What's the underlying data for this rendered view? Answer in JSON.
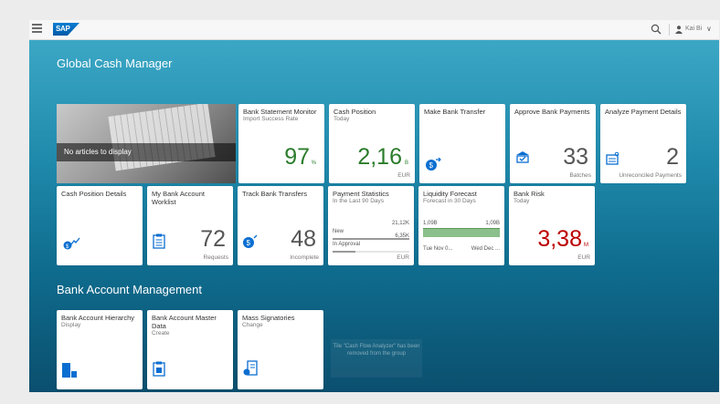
{
  "shell": {
    "logo": "SAP",
    "user_name": "Kai Bi"
  },
  "groups": {
    "global": "Global Cash Manager",
    "bank": "Bank Account Management"
  },
  "news": {
    "message": "No articles to display"
  },
  "tiles": {
    "bank_statement": {
      "title": "Bank Statement Monitor",
      "subtitle": "Import Success Rate",
      "value": "97",
      "scale": "%"
    },
    "cash_position": {
      "title": "Cash Position",
      "subtitle": "Today",
      "value": "2,16",
      "scale": "B",
      "unit": "EUR"
    },
    "make_transfer": {
      "title": "Make Bank Transfer"
    },
    "approve_payments": {
      "title": "Approve Bank Payments",
      "value": "33",
      "unit": "Batches"
    },
    "analyze_payment": {
      "title": "Analyze Payment Details",
      "value": "2",
      "unit": "Unreconciled Payments"
    },
    "cash_details": {
      "title": "Cash Position Details"
    },
    "worklist": {
      "title": "My Bank Account Worklist",
      "value": "72",
      "unit": "Requests"
    },
    "track_transfers": {
      "title": "Track Bank Transfers",
      "value": "48",
      "unit": "Incomplete"
    },
    "payment_stats": {
      "title": "Payment Statistics",
      "subtitle": "In the Last 90 Days",
      "unit": "EUR",
      "rows": [
        {
          "label": "New",
          "value": "21,12K",
          "fraction": 1.0
        },
        {
          "label": "In Approval",
          "value": "6,35K",
          "fraction": 0.3
        }
      ]
    },
    "liquidity": {
      "title": "Liquidity Forecast",
      "subtitle": "Forecast in 30 Days",
      "left_value": "1,09B",
      "right_value": "1,09B",
      "left_date": "Tue Nov 0...",
      "right_date": "Wed Dec ..."
    },
    "bank_risk": {
      "title": "Bank Risk",
      "subtitle": "Today",
      "value": "3,38",
      "scale": "M",
      "unit": "EUR"
    },
    "hierarchy": {
      "title": "Bank Account Hierarchy",
      "subtitle": "Display"
    },
    "master_data": {
      "title": "Bank Account Master Data",
      "subtitle": "Create"
    },
    "mass_signatories": {
      "title": "Mass Signatories",
      "subtitle": "Change"
    }
  },
  "ghost_note": "Tile \"Cash Flow Analyzer\" has been removed from the group",
  "colors": {
    "accent_green": "#2b7c2b",
    "accent_red": "#bb0000",
    "icon_blue": "#0a6ed1",
    "chart_green": "#8bbf8b"
  }
}
